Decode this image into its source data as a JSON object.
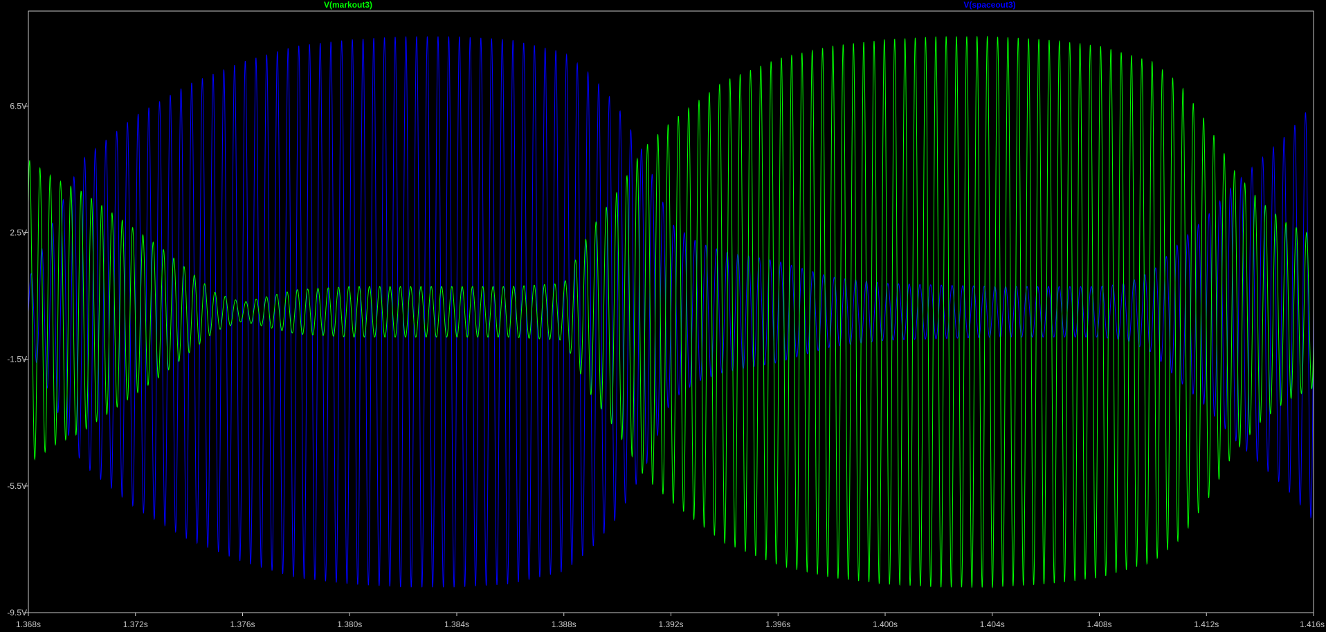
{
  "chart_data": {
    "type": "line",
    "title": "",
    "xlabel": "",
    "ylabel": "",
    "xlim": [
      1.368,
      1.416
    ],
    "ylim": [
      -9.5,
      9.5
    ],
    "grid": false,
    "background": "#000000",
    "axis_color": "#c8c8c8",
    "x_ticks": [
      {
        "value": 1.368,
        "label": "1.368s"
      },
      {
        "value": 1.372,
        "label": "1.372s"
      },
      {
        "value": 1.376,
        "label": "1.376s"
      },
      {
        "value": 1.38,
        "label": "1.380s"
      },
      {
        "value": 1.384,
        "label": "1.384s"
      },
      {
        "value": 1.388,
        "label": "1.388s"
      },
      {
        "value": 1.392,
        "label": "1.392s"
      },
      {
        "value": 1.396,
        "label": "1.396s"
      },
      {
        "value": 1.4,
        "label": "1.400s"
      },
      {
        "value": 1.404,
        "label": "1.404s"
      },
      {
        "value": 1.408,
        "label": "1.408s"
      },
      {
        "value": 1.412,
        "label": "1.412s"
      },
      {
        "value": 1.416,
        "label": "1.416s"
      }
    ],
    "y_ticks": [
      {
        "value": 6.5,
        "label": "6.5V"
      },
      {
        "value": 2.5,
        "label": "2.5V"
      },
      {
        "value": -1.5,
        "label": "-1.5V"
      },
      {
        "value": -5.5,
        "label": "-5.5V"
      },
      {
        "value": -9.5,
        "label": "-9.5V"
      }
    ],
    "series": [
      {
        "name": "V(spaceout3)",
        "color": "#0000ff",
        "offset": 0.0,
        "cycles_per_second": 2500,
        "envelope": [
          [
            1.368,
            1.0
          ],
          [
            1.369,
            3.0
          ],
          [
            1.37,
            4.8
          ],
          [
            1.372,
            6.2
          ],
          [
            1.374,
            7.2
          ],
          [
            1.376,
            7.9
          ],
          [
            1.378,
            8.4
          ],
          [
            1.38,
            8.6
          ],
          [
            1.382,
            8.7
          ],
          [
            1.384,
            8.7
          ],
          [
            1.386,
            8.6
          ],
          [
            1.388,
            8.2
          ],
          [
            1.389,
            7.5
          ],
          [
            1.39,
            6.5
          ],
          [
            1.391,
            5.0
          ],
          [
            1.392,
            2.8
          ],
          [
            1.393,
            2.2
          ],
          [
            1.394,
            1.9
          ],
          [
            1.396,
            1.6
          ],
          [
            1.398,
            1.1
          ],
          [
            1.4,
            0.9
          ],
          [
            1.404,
            0.8
          ],
          [
            1.408,
            0.8
          ],
          [
            1.409,
            0.9
          ],
          [
            1.41,
            1.3
          ],
          [
            1.411,
            2.2
          ],
          [
            1.412,
            3.0
          ],
          [
            1.413,
            4.0
          ],
          [
            1.414,
            4.8
          ],
          [
            1.415,
            5.6
          ],
          [
            1.416,
            6.6
          ]
        ]
      },
      {
        "name": "V(markout3)",
        "color": "#00ff00",
        "offset": 0.0,
        "cycles_per_second": 2600,
        "envelope": [
          [
            1.368,
            4.8
          ],
          [
            1.369,
            4.2
          ],
          [
            1.37,
            3.8
          ],
          [
            1.371,
            3.2
          ],
          [
            1.372,
            2.6
          ],
          [
            1.373,
            2.0
          ],
          [
            1.374,
            1.3
          ],
          [
            1.375,
            0.6
          ],
          [
            1.376,
            0.3
          ],
          [
            1.377,
            0.5
          ],
          [
            1.378,
            0.7
          ],
          [
            1.38,
            0.8
          ],
          [
            1.384,
            0.8
          ],
          [
            1.386,
            0.8
          ],
          [
            1.388,
            0.9
          ],
          [
            1.389,
            2.6
          ],
          [
            1.39,
            3.8
          ],
          [
            1.391,
            5.2
          ],
          [
            1.392,
            6.0
          ],
          [
            1.394,
            7.3
          ],
          [
            1.396,
            8.0
          ],
          [
            1.398,
            8.4
          ],
          [
            1.4,
            8.6
          ],
          [
            1.402,
            8.7
          ],
          [
            1.404,
            8.7
          ],
          [
            1.406,
            8.6
          ],
          [
            1.408,
            8.4
          ],
          [
            1.41,
            7.9
          ],
          [
            1.411,
            7.2
          ],
          [
            1.412,
            6.0
          ],
          [
            1.413,
            4.5
          ],
          [
            1.414,
            3.5
          ],
          [
            1.415,
            2.8
          ],
          [
            1.416,
            2.4
          ]
        ]
      }
    ]
  }
}
